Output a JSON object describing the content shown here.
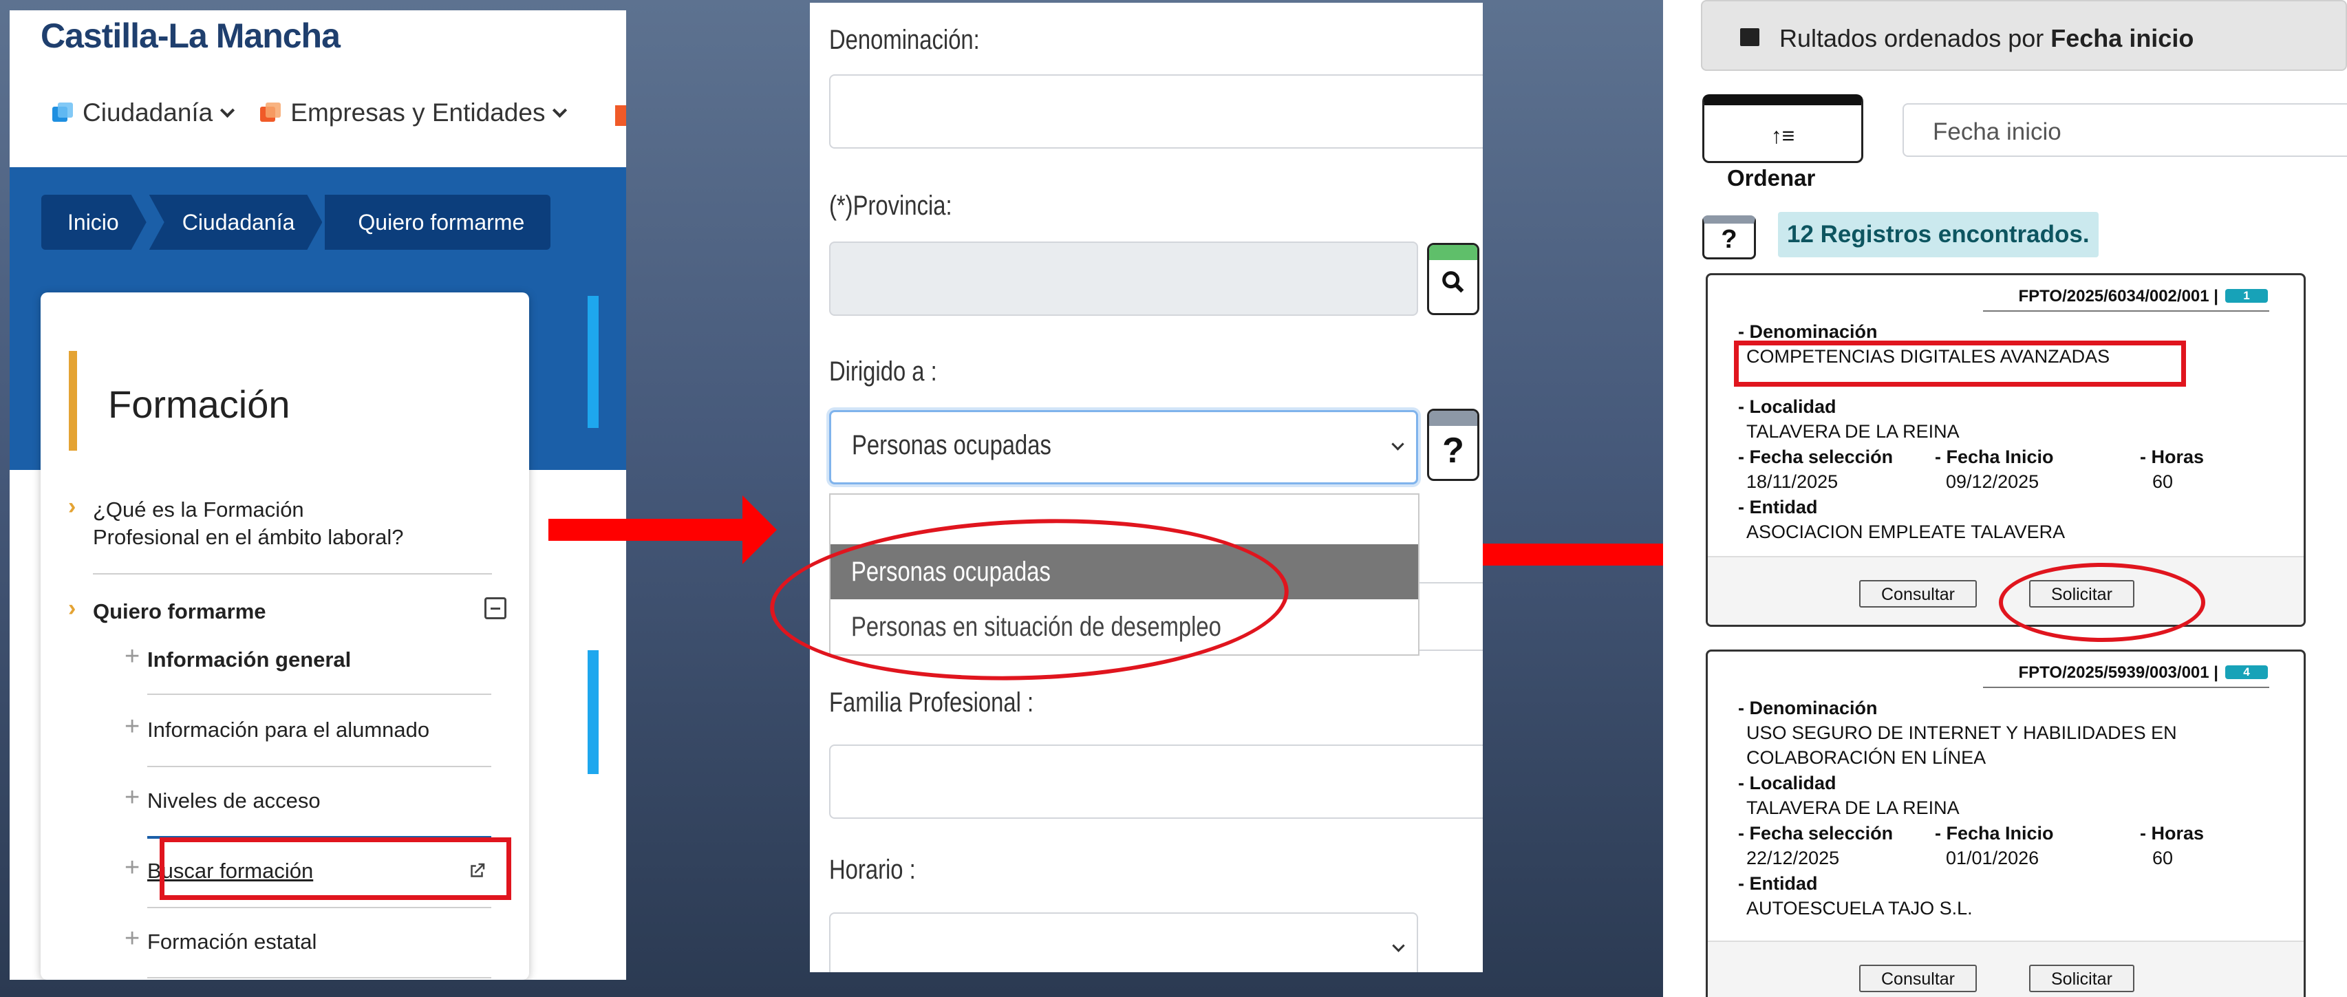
{
  "panel1": {
    "brand": "Castilla-La Mancha",
    "topnav": [
      {
        "label": "Ciudadanía",
        "icon": "ciudadania-squares-icon",
        "color": "#1f8fe0"
      },
      {
        "label": "Empresas y Entidades",
        "icon": "empresas-squares-icon",
        "color": "#f05a28"
      }
    ],
    "breadcrumb": [
      "Inicio",
      "Ciudadanía",
      "Quiero formarme"
    ],
    "card_title": "Formación",
    "menu": {
      "item1_line1": "¿Qué es la Formación",
      "item1_line2": "Profesional en el ámbito laboral?",
      "section": "Quiero formarme",
      "sub": [
        "Información general",
        "Información para el alumnado",
        "Niveles de acceso",
        "Buscar formación",
        "Formación estatal"
      ]
    },
    "colors": {
      "hero": "#1b5fa8",
      "crumb": "#0c3e7c",
      "accent": "#e4a333",
      "side_accent": "#1ea7ee"
    }
  },
  "panel2": {
    "labels": {
      "denominacion": "Denominación:",
      "provincia": "(*)Provincia:",
      "dirigido": "Dirigido a :",
      "familia": "Familia Profesional :",
      "horario": "Horario :"
    },
    "dirigido_value": "Personas ocupadas",
    "options": [
      "Personas ocupadas",
      "Personas en situación de desempleo"
    ],
    "search_glyph": "🔍",
    "help_glyph": "?"
  },
  "panel3": {
    "banner_prefix": "Rultados ordenados por ",
    "banner_bold": "Fecha inicio",
    "sort_glyph": "↑≡",
    "ordenar_label": "Ordenar",
    "sort_field_value": "Fecha inicio",
    "help_glyph": "?",
    "count": "12 Registros encontrados.",
    "labels": {
      "denominacion": "- Denominación",
      "localidad": "- Localidad",
      "fecha_seleccion": "- Fecha selección",
      "fecha_inicio": "- Fecha Inicio",
      "horas": "- Horas",
      "entidad": "- Entidad"
    },
    "results": [
      {
        "code": "FPTO/2025/6034/002/001 |",
        "badge": "1",
        "denominacion": [
          "COMPETENCIAS DIGITALES AVANZADAS"
        ],
        "localidad": "TALAVERA DE LA REINA",
        "fecha_seleccion": "18/11/2025",
        "fecha_inicio": "09/12/2025",
        "horas": "60",
        "entidad": "ASOCIACION EMPLEATE TALAVERA",
        "btn_consultar": "Consultar",
        "btn_solicitar": "Solicitar"
      },
      {
        "code": "FPTO/2025/5939/003/001 |",
        "badge": "4",
        "denominacion": [
          "USO SEGURO DE INTERNET Y HABILIDADES EN",
          "COLABORACIÓN EN LÍNEA"
        ],
        "localidad": "TALAVERA DE LA REINA",
        "fecha_seleccion": "22/12/2025",
        "fecha_inicio": "01/01/2026",
        "horas": "60",
        "entidad": "AUTOESCUELA TAJO S.L.",
        "btn_consultar": "Consultar",
        "btn_solicitar": "Solicitar"
      }
    ],
    "badge_color": "#17a2b8"
  },
  "annotation_color": "#e0151e"
}
